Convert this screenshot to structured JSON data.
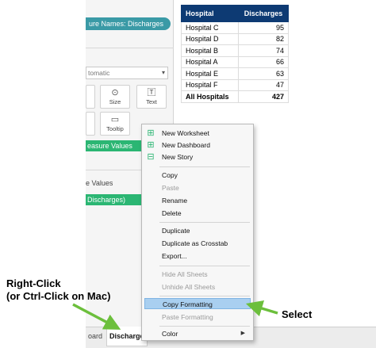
{
  "left_panel": {
    "pill_text": "ure Names: Discharges",
    "marks_dropdown": "tomatic",
    "mark_buttons": [
      {
        "label": "",
        "icon": "color-icon"
      },
      {
        "label": "Size",
        "icon": "size-icon"
      },
      {
        "label": "Text",
        "icon": "text-icon"
      },
      {
        "label": "",
        "icon": "detail-icon"
      },
      {
        "label": "Tooltip",
        "icon": "tooltip-icon"
      }
    ],
    "measure_values_pill": "easure Values",
    "measure_values_label": "e Values",
    "discharges_pill": "Discharges)"
  },
  "table": {
    "headers": [
      "Hospital",
      "Discharges"
    ],
    "rows": [
      [
        "Hospital C",
        "95"
      ],
      [
        "Hospital D",
        "82"
      ],
      [
        "Hospital B",
        "74"
      ],
      [
        "Hospital A",
        "66"
      ],
      [
        "Hospital E",
        "63"
      ],
      [
        "Hospital F",
        "47"
      ]
    ],
    "total": [
      "All Hospitals",
      "427"
    ]
  },
  "menu": {
    "items": [
      {
        "label": "New Worksheet",
        "enabled": true,
        "icon": "new-worksheet-icon"
      },
      {
        "label": "New Dashboard",
        "enabled": true,
        "icon": "new-dashboard-icon"
      },
      {
        "label": "New Story",
        "enabled": true,
        "icon": "new-story-icon"
      },
      {
        "label": "Copy",
        "enabled": true
      },
      {
        "label": "Paste",
        "enabled": false
      },
      {
        "label": "Rename",
        "enabled": true
      },
      {
        "label": "Delete",
        "enabled": true
      },
      {
        "label": "Duplicate",
        "enabled": true
      },
      {
        "label": "Duplicate as Crosstab",
        "enabled": true
      },
      {
        "label": "Export...",
        "enabled": true
      },
      {
        "label": "Hide All Sheets",
        "enabled": false
      },
      {
        "label": "Unhide All Sheets",
        "enabled": false
      },
      {
        "label": "Copy Formatting",
        "enabled": true,
        "highlighted": true
      },
      {
        "label": "Paste Formatting",
        "enabled": false
      },
      {
        "label": "Color",
        "enabled": true,
        "submenu": true
      }
    ]
  },
  "tabs": {
    "partial": "oard",
    "active": "Discharge"
  },
  "annotations": {
    "right_click_line1": "Right-Click",
    "right_click_line2": "(or Ctrl-Click on Mac)",
    "select": "Select"
  },
  "colors": {
    "table_header": "#0d3a73",
    "pill_teal": "#3a9aa6",
    "pill_green": "#2bb673",
    "arrow_green": "#6cbf3c",
    "menu_highlight": "#a9cff0"
  }
}
